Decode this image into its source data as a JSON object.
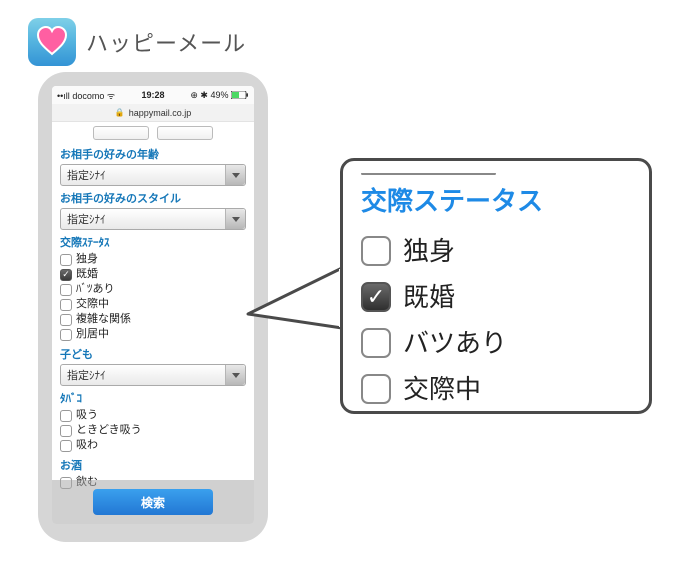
{
  "app": {
    "name": "ハッピーメール"
  },
  "status": {
    "carrier": "docomo",
    "signal": "••ıll",
    "wifi": "ᯤ",
    "time": "19:28",
    "icons_right": "⊕ ✱ 49%",
    "battery": ""
  },
  "urlbar": {
    "lock_icon": "lock-icon",
    "host": "happymail.co.jp"
  },
  "sections": {
    "age": {
      "title": "お相手の好みの年齢",
      "select_value": "指定ｼﾅｲ"
    },
    "style": {
      "title": "お相手の好みのスタイル",
      "select_value": "指定ｼﾅｲ"
    },
    "status": {
      "title": "交際ｽﾃｰﾀｽ",
      "items": [
        {
          "label": "独身",
          "checked": false
        },
        {
          "label": "既婚",
          "checked": true
        },
        {
          "label": "ﾊﾞﾂあり",
          "checked": false
        },
        {
          "label": "交際中",
          "checked": false
        },
        {
          "label": "複雑な関係",
          "checked": false
        },
        {
          "label": "別居中",
          "checked": false
        }
      ]
    },
    "children": {
      "title": "子ども",
      "select_value": "指定ｼﾅｲ"
    },
    "tobacco": {
      "title": "ﾀﾊﾞｺ",
      "items": [
        {
          "label": "吸う",
          "checked": false
        },
        {
          "label": "ときどき吸う",
          "checked": false
        },
        {
          "label": "吸わ",
          "checked": false
        }
      ]
    },
    "alcohol": {
      "title": "お酒",
      "items": [
        {
          "label": "飲む",
          "checked": false
        }
      ]
    }
  },
  "search_button": "検索",
  "callout": {
    "title": "交際ステータス",
    "items": [
      {
        "label": "独身",
        "checked": false
      },
      {
        "label": "既婚",
        "checked": true
      },
      {
        "label": "バツあり",
        "checked": false
      },
      {
        "label": "交際中",
        "checked": false
      }
    ]
  }
}
